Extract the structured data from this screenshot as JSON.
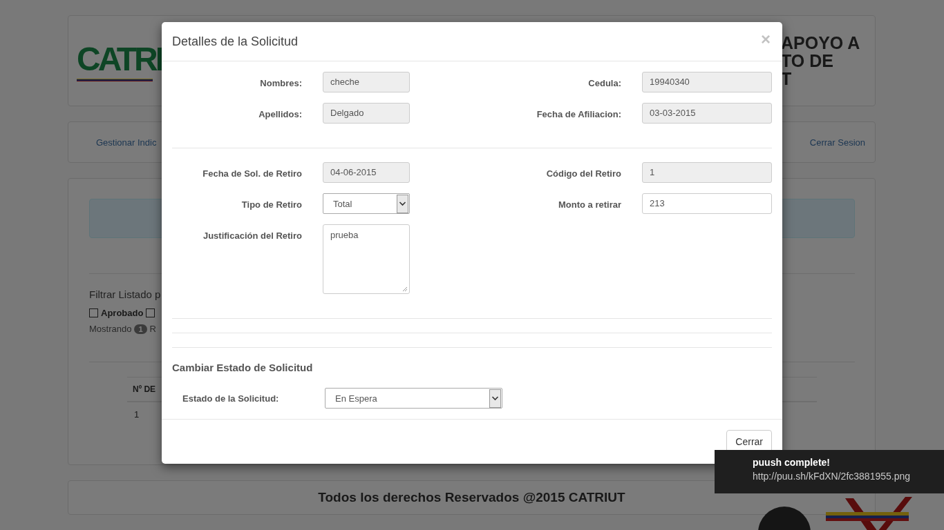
{
  "background_page": {
    "header": {
      "logo_text": "CATRI",
      "title_lines": [
        "APOYO A",
        "TO DE",
        "T"
      ]
    },
    "nav": {
      "left_link": "Gestionar Indic",
      "right_link": "Cerrar Sesion"
    },
    "content": {
      "filter_label": "Filtrar Listado p",
      "filters": [
        {
          "label": "Aprobado",
          "checked": false
        },
        {
          "checked": false
        }
      ],
      "showing": {
        "prefix": "Mostrando",
        "count": "1",
        "suffix": "R"
      },
      "table": {
        "columns": [
          "Nº DE"
        ],
        "rows": [
          [
            "1"
          ]
        ]
      }
    },
    "footer": "Todos los derechos Reservados @2015 CATRIUT"
  },
  "modal": {
    "title": "Detalles de la Solicitud",
    "close": "×",
    "sections": [
      {
        "fields": [
          {
            "label": "Nombres:",
            "value": "cheche",
            "kind": "text",
            "readonly": true
          },
          {
            "label": "Cedula:",
            "value": "19940340",
            "kind": "text",
            "readonly": true
          },
          {
            "label": "Apellidos:",
            "value": "Delgado",
            "kind": "text",
            "readonly": true
          },
          {
            "label": "Fecha de Afiliacion:",
            "value": "03-03-2015",
            "kind": "text",
            "readonly": true
          }
        ]
      },
      {
        "fields": [
          {
            "label": "Fecha de Sol. de Retiro",
            "value": "04-06-2015",
            "kind": "text",
            "readonly": true
          },
          {
            "label": "Código del Retiro",
            "value": "1",
            "kind": "text",
            "readonly": true
          },
          {
            "label": "Tipo de Retiro",
            "value": "Total",
            "kind": "select",
            "readonly": false
          },
          {
            "label": "Monto a retirar",
            "value": "213",
            "kind": "text",
            "readonly": false
          },
          {
            "label": "Justificación del Retiro",
            "value": "prueba",
            "kind": "textarea",
            "readonly": false
          }
        ]
      }
    ],
    "status_heading": "Cambiar Estado de Solicitud",
    "status_field": {
      "label": "Estado de la Solicitud:",
      "value": "En Espera"
    },
    "buttons": [
      "Cerrar"
    ]
  },
  "notification": {
    "title": "puush complete!",
    "url": "http://puu.sh/kFdXN/2fc3881955.png"
  }
}
